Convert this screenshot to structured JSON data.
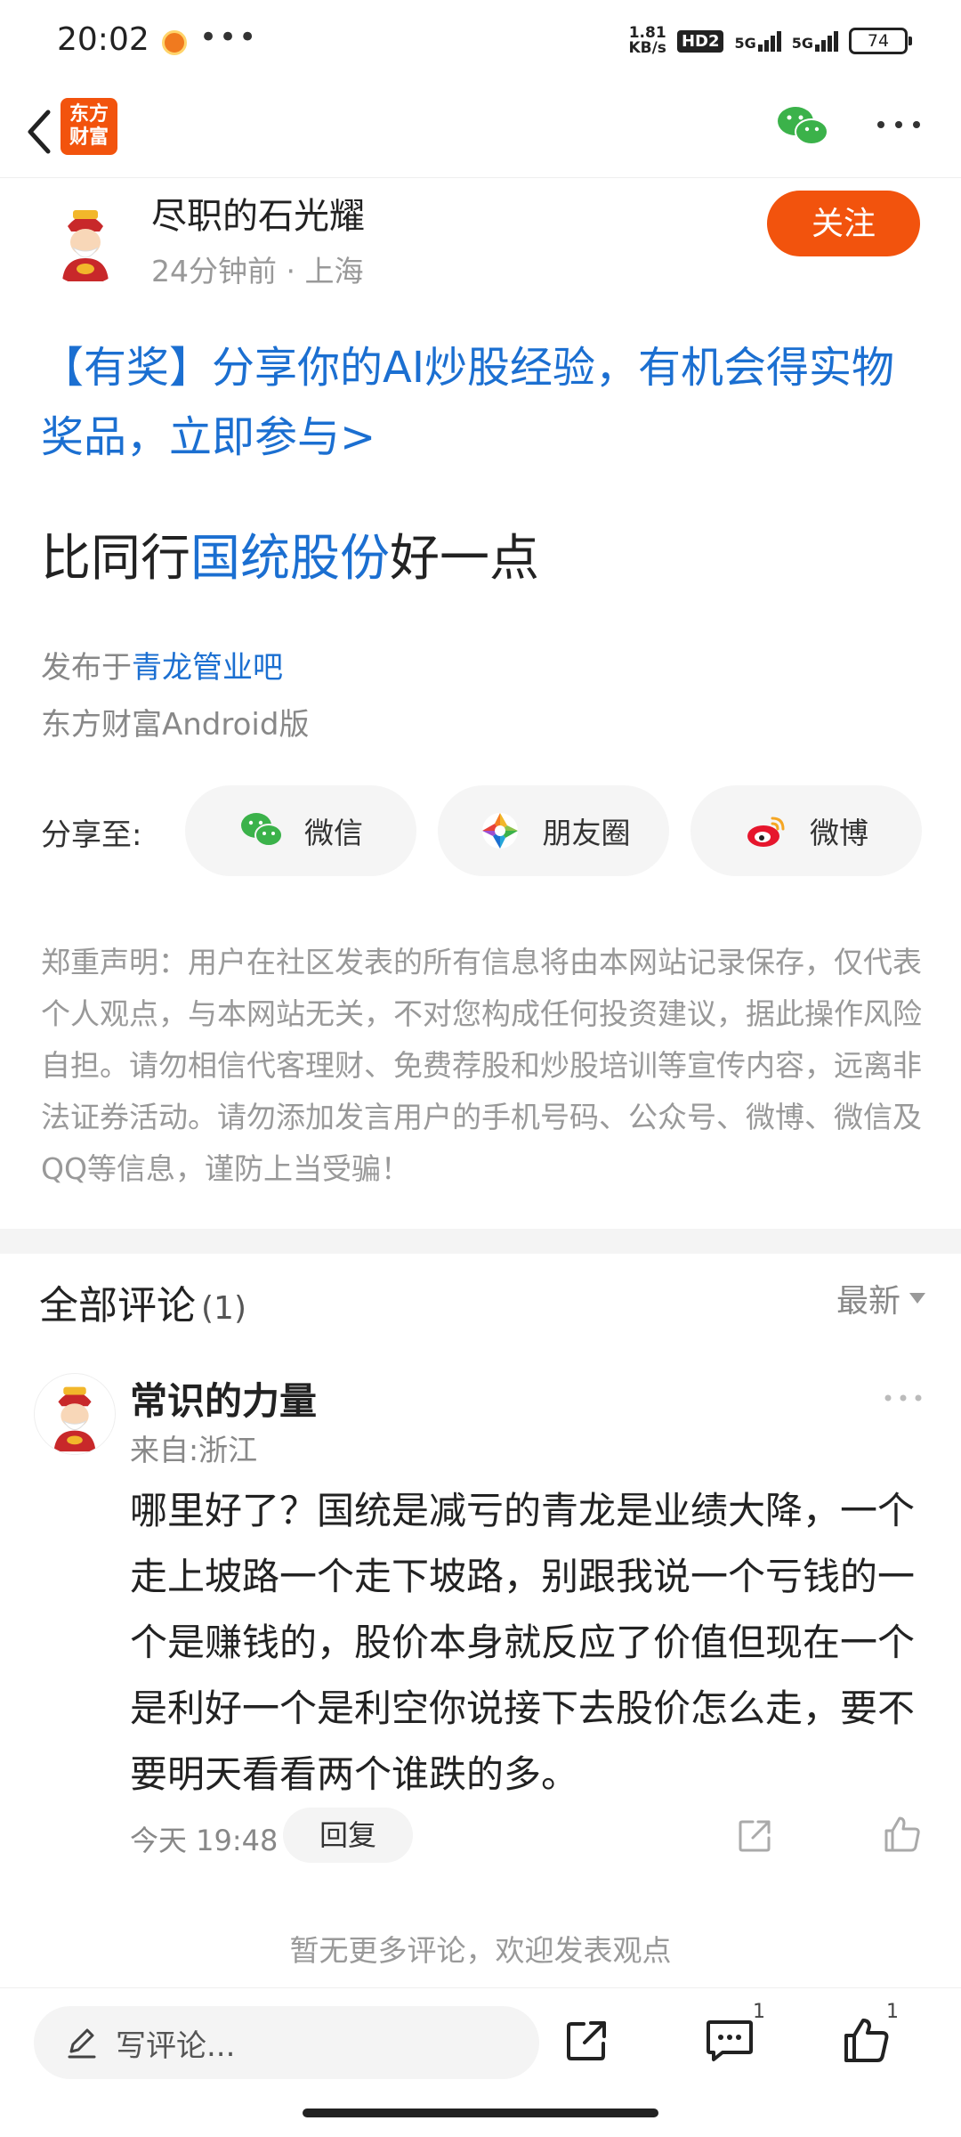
{
  "status_bar": {
    "time": "20:02",
    "speed_value": "1.81",
    "speed_unit": "KB/s",
    "hd": "HD2",
    "net1": "5G",
    "net2": "5G",
    "battery": "74"
  },
  "nav": {
    "logo_line1": "东方",
    "logo_line2": "财富"
  },
  "post": {
    "author": "尽职的石光耀",
    "time": "24分钟前",
    "location": "上海",
    "follow_label": "关注",
    "promo": "【有奖】分享你的AI炒股经验，有机会得实物奖品，立即参与>",
    "title_prefix": "比同行",
    "title_stock": "国统股份",
    "title_suffix": "好一点",
    "published_prefix": "发布于",
    "bar_name": "青龙管业吧",
    "client": "东方财富Android版"
  },
  "share": {
    "label": "分享至:",
    "wechat": "微信",
    "moments": "朋友圈",
    "weibo": "微博"
  },
  "disclaimer": "郑重声明：用户在社区发表的所有信息将由本网站记录保存，仅代表个人观点，与本网站无关，不对您构成任何投资建议，据此操作风险自担。请勿相信代客理财、免费荐股和炒股培训等宣传内容，远离非法证券活动。请勿添加发言用户的手机号码、公众号、微博、微信及QQ等信息，谨防上当受骗！",
  "comments": {
    "title": "全部评论",
    "count": "(1)",
    "sort": "最新",
    "items": [
      {
        "name": "常识的力量",
        "location": "来自:浙江",
        "text": "哪里好了？国统是减亏的青龙是业绩大降，一个走上坡路一个走下坡路，别跟我说一个亏钱的一个是赚钱的，股价本身就反应了价值但现在一个是利好一个是利空你说接下去股价怎么走，要不要明天看看两个谁跌的多。",
        "time": "今天 19:48",
        "reply_label": "回复"
      }
    ],
    "no_more": "暂无更多评论，欢迎发表观点"
  },
  "bottom": {
    "write_placeholder": "写评论...",
    "comment_count": "1",
    "like_count": "1"
  },
  "colors": {
    "brand": "#f2530d",
    "link": "#1b6fd1"
  }
}
